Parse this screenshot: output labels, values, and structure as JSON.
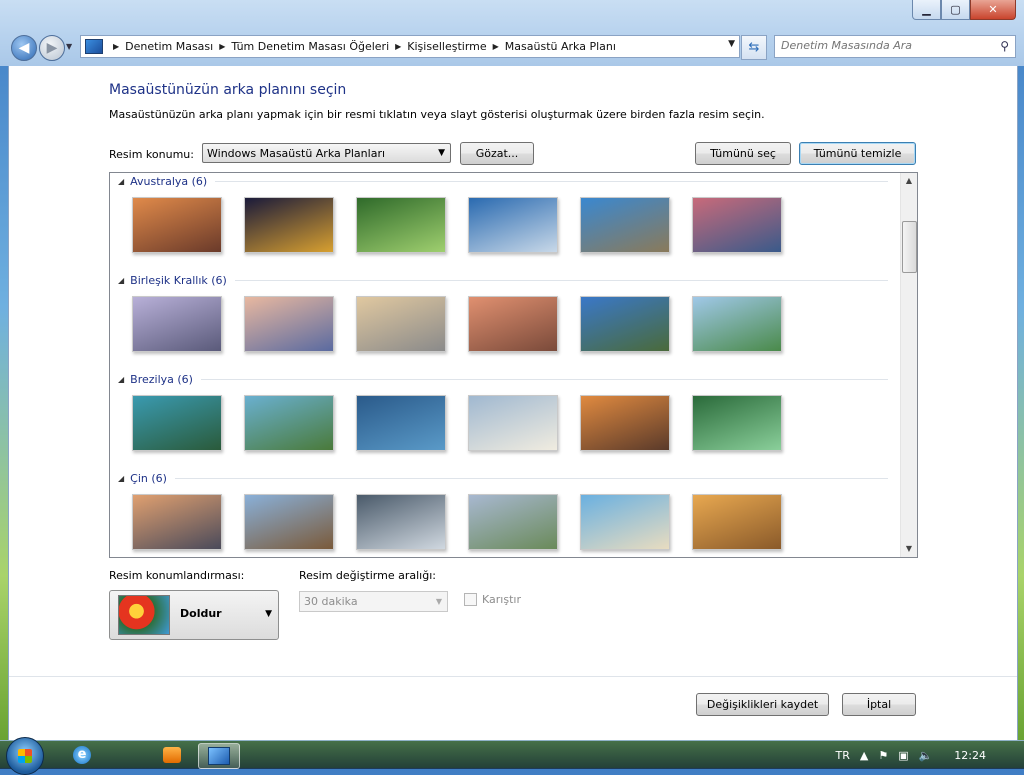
{
  "window": {
    "caption": {
      "minimize": "▁",
      "maximize": "▢",
      "close": "✕"
    }
  },
  "nav": {
    "back": "◀",
    "forward": "▶"
  },
  "address": {
    "crumbs": [
      "Denetim Masası",
      "Tüm Denetim Masası Öğeleri",
      "Kişiselleştirme",
      "Masaüstü Arka Planı"
    ]
  },
  "search": {
    "placeholder": "Denetim Masasında Ara"
  },
  "page": {
    "title": "Masaüstünüzün arka planını seçin",
    "description": "Masaüstünüzün arka planı yapmak için bir resmi tıklatın veya slayt gösterisi oluşturmak üzere birden fazla resim seçin.",
    "location_label": "Resim konumu:",
    "location_value": "Windows Masaüstü Arka Planları",
    "browse": "Gözat...",
    "select_all": "Tümünü seç",
    "clear_all": "Tümünü temizle"
  },
  "groups": [
    {
      "title": "Avustralya (6)",
      "colors": [
        [
          "#e08a4a",
          "#6a3a2a"
        ],
        [
          "#1a1a3a",
          "#d8a030"
        ],
        [
          "#2f6a2a",
          "#9fcf6f"
        ],
        [
          "#2a6ab0",
          "#c8d8e8"
        ],
        [
          "#3a88d0",
          "#8a7a5a"
        ],
        [
          "#c86a7a",
          "#3a5a8a"
        ]
      ]
    },
    {
      "title": "Birleşik Krallık (6)",
      "colors": [
        [
          "#b8b0d8",
          "#5a5a7a"
        ],
        [
          "#e8b8a0",
          "#5a6aa0"
        ],
        [
          "#e0c8a0",
          "#8a8a8a"
        ],
        [
          "#e09070",
          "#7a4a3a"
        ],
        [
          "#3a78c8",
          "#4a6a3a"
        ],
        [
          "#a0c8e8",
          "#4a8a4a"
        ]
      ]
    },
    {
      "title": "Brezilya (6)",
      "colors": [
        [
          "#3a9ab0",
          "#2a5a3a"
        ],
        [
          "#6ab0d0",
          "#4a7a3a"
        ],
        [
          "#2a5a8a",
          "#5a9ac8"
        ],
        [
          "#a0b8d0",
          "#f0ece0"
        ],
        [
          "#e08a40",
          "#5a3a2a"
        ],
        [
          "#2a6a3a",
          "#8acf9a"
        ]
      ]
    },
    {
      "title": "Çin (6)",
      "colors": [
        [
          "#e0a070",
          "#4a4a5a"
        ],
        [
          "#8ab0d8",
          "#7a5a3a"
        ],
        [
          "#4a5a6a",
          "#d0d8e0"
        ],
        [
          "#a8b8d0",
          "#6a8a5a"
        ],
        [
          "#6ab0e0",
          "#e8dcc0"
        ],
        [
          "#e8a850",
          "#8a5a2a"
        ]
      ]
    }
  ],
  "positioning": {
    "label": "Resim konumlandırması:",
    "value": "Doldur"
  },
  "interval": {
    "label": "Resim değiştirme aralığı:",
    "value": "30 dakika"
  },
  "shuffle": {
    "label": "Karıştır"
  },
  "footer": {
    "save": "Değişiklikleri kaydet",
    "cancel": "İptal"
  },
  "taskbar": {
    "lang": "TR",
    "clock": "12:24"
  }
}
